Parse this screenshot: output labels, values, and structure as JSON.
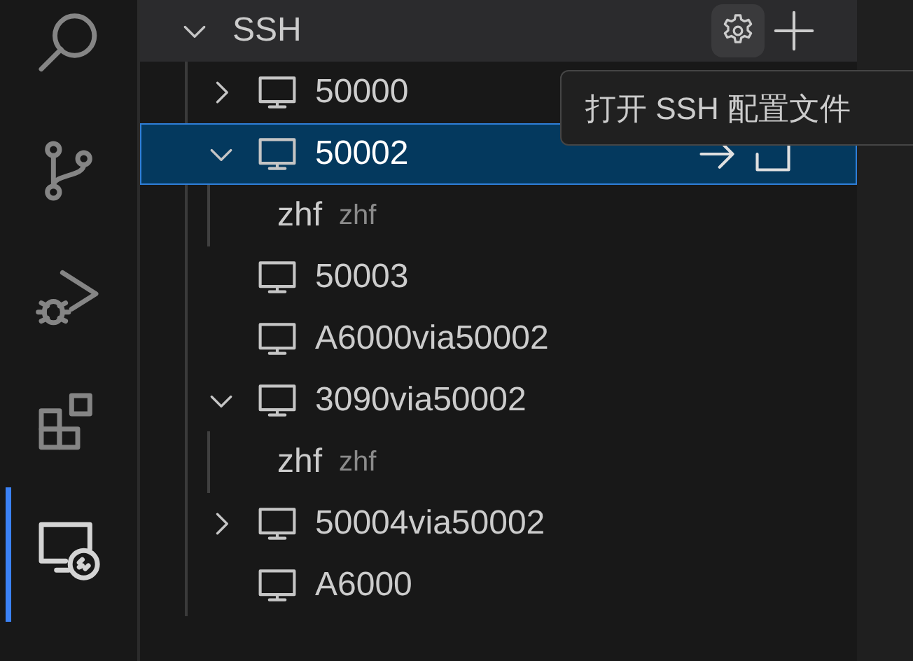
{
  "section": {
    "title": "SSH",
    "expanded": true
  },
  "tooltip": {
    "text": "打开 SSH 配置文件"
  },
  "activity_bar": [
    {
      "kind": "search",
      "selected": false
    },
    {
      "kind": "source-control",
      "selected": false
    },
    {
      "kind": "debug",
      "selected": false
    },
    {
      "kind": "extensions",
      "selected": false
    },
    {
      "kind": "remote",
      "selected": true
    }
  ],
  "hosts": [
    {
      "label": "50000",
      "kind": "collapsible",
      "expanded": false,
      "selected": false
    },
    {
      "label": "50002",
      "kind": "collapsible",
      "expanded": true,
      "selected": true,
      "children": [
        {
          "label": "zhf",
          "description": "zhf"
        }
      ]
    },
    {
      "label": "50003",
      "kind": "leaf",
      "selected": false
    },
    {
      "label": "A6000via50002",
      "kind": "leaf",
      "selected": false
    },
    {
      "label": "3090via50002",
      "kind": "collapsible",
      "expanded": true,
      "selected": false,
      "children": [
        {
          "label": "zhf",
          "description": "zhf"
        }
      ]
    },
    {
      "label": "50004via50002",
      "kind": "collapsible",
      "expanded": false,
      "selected": false
    },
    {
      "label": "A6000",
      "kind": "leaf",
      "selected": false
    }
  ]
}
